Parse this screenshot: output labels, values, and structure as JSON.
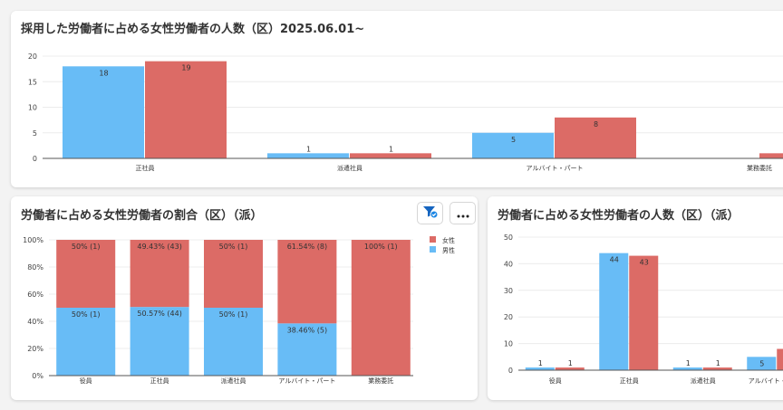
{
  "colors": {
    "male": "#68bcf6",
    "female": "#dc6b66",
    "grid": "#ececec",
    "axis": "#555555"
  },
  "cards": [
    {
      "title": "採用した労働者に占める女性労働者の人数（区）2025.06.01~"
    },
    {
      "title": "労働者に占める女性労働者の割合（区）（派）",
      "filter_icon": "filter-check-icon",
      "more_icon": "more-dots-icon"
    },
    {
      "title": "労働者に占める女性労働者の人数（区）（派）"
    }
  ],
  "chart_data": [
    {
      "type": "bar",
      "title": "採用した労働者に占める女性労働者の人数（区）2025.06.01~",
      "categories": [
        "正社員",
        "派遣社員",
        "アルバイト・パート",
        "業務委託"
      ],
      "series": [
        {
          "name": "男性",
          "values": [
            18,
            1,
            5,
            0
          ]
        },
        {
          "name": "女性",
          "values": [
            19,
            1,
            8,
            1
          ]
        }
      ],
      "data_labels": [
        [
          "18",
          "1",
          "5",
          ""
        ],
        [
          "19",
          "1",
          "8",
          ""
        ]
      ],
      "ylim": [
        0,
        20
      ],
      "yticks": [
        "0",
        "5",
        "10",
        "15",
        "20"
      ],
      "grid": true
    },
    {
      "type": "bar",
      "stacked": true,
      "title": "労働者に占める女性労働者の割合（区）（派）",
      "categories": [
        "役員",
        "正社員",
        "派遣社員",
        "アルバイト・パート",
        "業務委託"
      ],
      "series": [
        {
          "name": "男性",
          "values": [
            50,
            50.57,
            50,
            38.46,
            0
          ],
          "labels": [
            "50% (1)",
            "50.57% (44)",
            "50% (1)",
            "38.46% (5)",
            ""
          ]
        },
        {
          "name": "女性",
          "values": [
            50,
            49.43,
            50,
            61.54,
            100
          ],
          "labels": [
            "50% (1)",
            "49.43% (43)",
            "50% (1)",
            "61.54% (8)",
            "100% (1)"
          ]
        }
      ],
      "ylim": [
        0,
        100
      ],
      "yticks": [
        "0%",
        "20%",
        "40%",
        "60%",
        "80%",
        "100%"
      ],
      "legend": {
        "placement": "top-right",
        "items": [
          "女性",
          "男性"
        ]
      },
      "grid": true
    },
    {
      "type": "bar",
      "title": "労働者に占める女性労働者の人数（区）（派）",
      "categories": [
        "役員",
        "正社員",
        "派遣社員",
        "アルバイト・パート"
      ],
      "series": [
        {
          "name": "男性",
          "values": [
            1,
            44,
            1,
            5
          ]
        },
        {
          "name": "女性",
          "values": [
            1,
            43,
            1,
            8
          ]
        }
      ],
      "data_labels": [
        [
          "1",
          "44",
          "1",
          "5"
        ],
        [
          "1",
          "43",
          "1",
          ""
        ]
      ],
      "ylim": [
        0,
        50
      ],
      "yticks": [
        "0",
        "10",
        "20",
        "30",
        "40",
        "50"
      ],
      "grid": true
    }
  ]
}
